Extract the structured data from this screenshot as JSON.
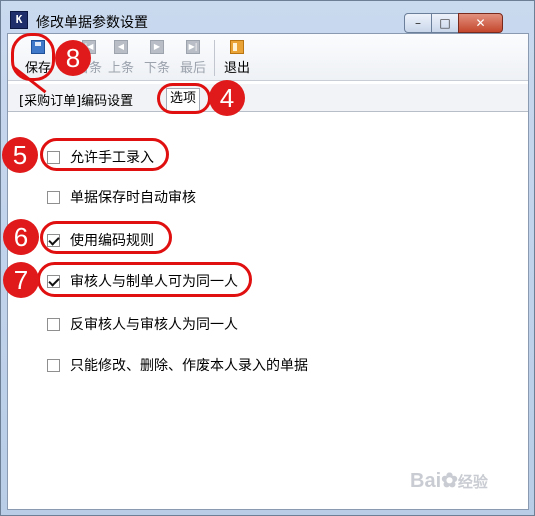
{
  "window": {
    "title": "修改单据参数设置",
    "icon": "app-logo-icon"
  },
  "toolbar": {
    "save": "保存",
    "first": "首条",
    "prev": "上条",
    "next": "下条",
    "last": "最后",
    "exit": "退出"
  },
  "tabs": {
    "breadcrumb": "[采购订单]编码设置",
    "options": "选项"
  },
  "options": [
    {
      "label": "允许手工录入",
      "checked": false
    },
    {
      "label": "单据保存时自动审核",
      "checked": false
    },
    {
      "label": "使用编码规则",
      "checked": true
    },
    {
      "label": "审核人与制单人可为同一人",
      "checked": true
    },
    {
      "label": "反审核人与审核人为同一人",
      "checked": false
    },
    {
      "label": "只能修改、删除、作废本人录入的单据",
      "checked": false
    }
  ],
  "annotations": {
    "n4": "4",
    "n5": "5",
    "n6": "6",
    "n7": "7",
    "n8": "8"
  },
  "watermark": {
    "brand": "Bai",
    "cn": "经验"
  },
  "colors": {
    "annotation": "#e01010",
    "close_button": "#c4472d"
  }
}
